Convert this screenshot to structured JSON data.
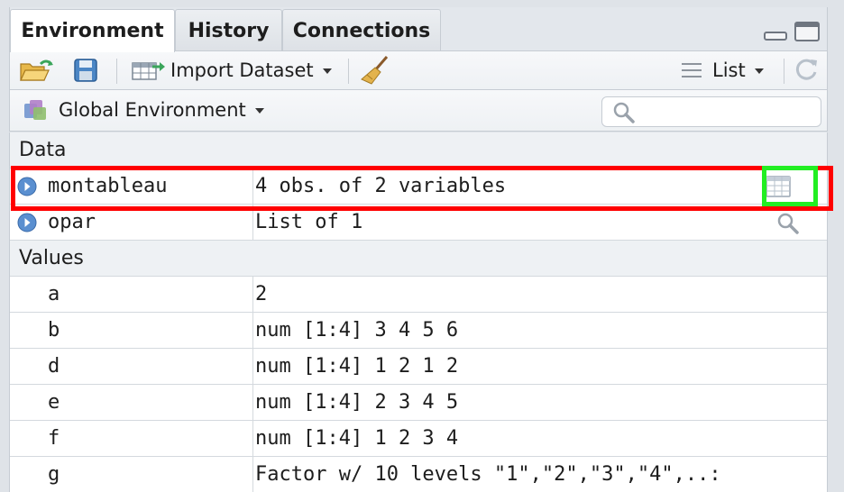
{
  "tabs": [
    {
      "label": "Environment",
      "active": true
    },
    {
      "label": "History",
      "active": false
    },
    {
      "label": "Connections",
      "active": false
    }
  ],
  "toolbar": {
    "import_dataset_label": "Import Dataset",
    "view_mode_label": "List"
  },
  "envbar": {
    "environment_label": "Global Environment",
    "search_placeholder": ""
  },
  "sections": {
    "data_label": "Data",
    "values_label": "Values"
  },
  "data_rows": [
    {
      "name": "montableau",
      "value": "4 obs. of 2 variables",
      "action_icon": "table-view-icon"
    },
    {
      "name": "opar",
      "value": "List of 1",
      "action_icon": "magnifier-icon"
    }
  ],
  "value_rows": [
    {
      "name": "a",
      "value": "2"
    },
    {
      "name": "b",
      "value": "num [1:4] 3 4 5 6"
    },
    {
      "name": "d",
      "value": "num [1:4] 1 2 1 2"
    },
    {
      "name": "e",
      "value": "num [1:4] 2 3 4 5"
    },
    {
      "name": "f",
      "value": "num [1:4] 1 2 3 4"
    },
    {
      "name": "g",
      "value": "Factor w/ 10 levels \"1\",\"2\",\"3\",\"4\",..:"
    }
  ],
  "colors": {
    "highlight_red": "#ff0000",
    "highlight_green": "#22ee22",
    "expand_icon_blue": "#5a8fd0"
  }
}
